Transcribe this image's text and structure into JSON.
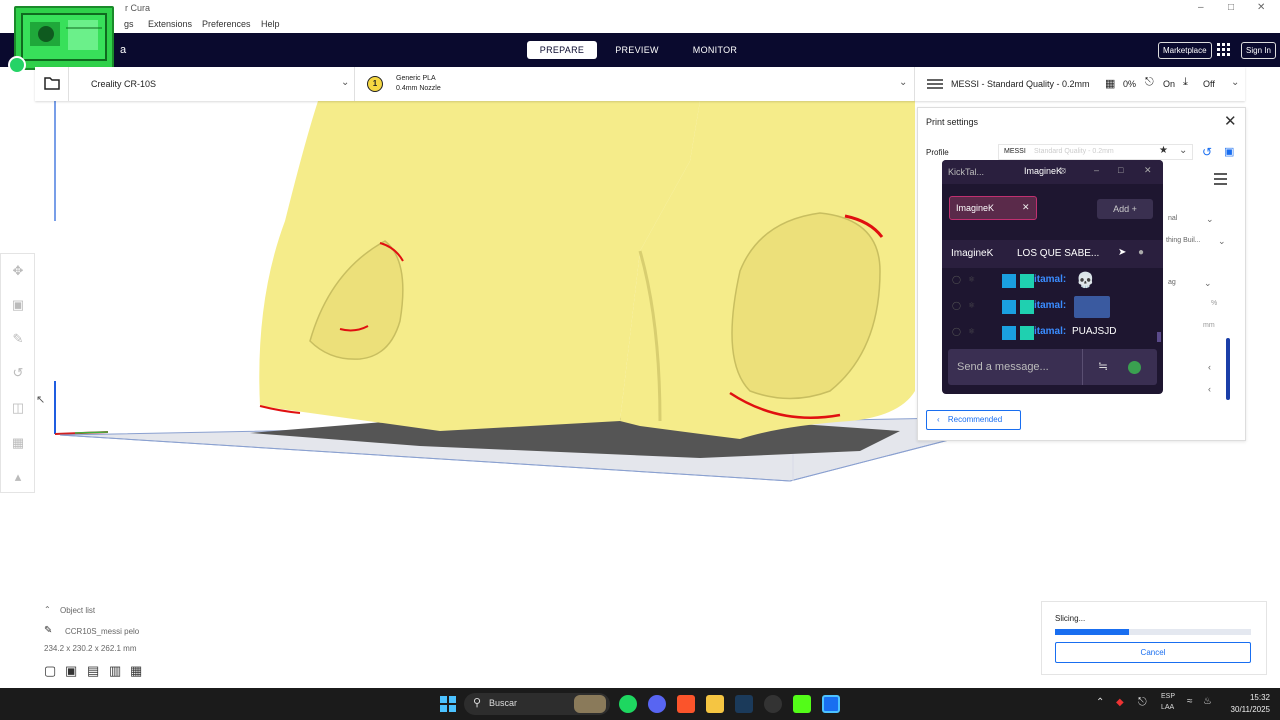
{
  "window": {
    "title": "r Cura"
  },
  "menu": {
    "items": [
      "gs",
      "Extensions",
      "Preferences",
      "Help"
    ]
  },
  "header": {
    "logo_suffix": "a",
    "tabs": [
      "PREPARE",
      "PREVIEW",
      "MONITOR"
    ],
    "active_tab": "PREPARE",
    "marketplace": "Marketplace",
    "signin": "Sign In"
  },
  "toolbar": {
    "printer": "Creality CR-10S",
    "extruder_number": "1",
    "material": "Generic PLA",
    "nozzle": "0.4mm Nozzle",
    "profile": "MESSI - Standard Quality - 0.2mm",
    "infill": "0%",
    "support": "On",
    "adhesion": "Off"
  },
  "print_settings": {
    "title": "Print settings",
    "profile_label": "Profile",
    "profile_value": "MESSI",
    "profile_hint": "Standard Quality - 0.2mm",
    "row_fragments": [
      "nal",
      "thing Buil...",
      "ag",
      "%",
      "mm"
    ],
    "recommended_label": "Recommended"
  },
  "chat": {
    "app_tab": "KickTal...",
    "channel_tab": "ImagineK",
    "channel_pill": "ImagineK",
    "add_label": "Add",
    "header_channel": "ImagineK",
    "header_title": "LOS QUE SABE...",
    "messages": [
      {
        "user": "itamal:",
        "text": "💀"
      },
      {
        "user": "itamal:",
        "text": ""
      },
      {
        "user": "itamal:",
        "text": "PUAJSJD"
      }
    ],
    "input_placeholder": "Send a message..."
  },
  "object_list": {
    "title": "Object list",
    "object_name": "CCR10S_messi pelo",
    "dimensions": "234.2 x 230.2 x 262.1 mm"
  },
  "slicing": {
    "label": "Slicing...",
    "progress": 0.38,
    "cancel": "Cancel"
  },
  "taskbar": {
    "search": "Buscar",
    "language": "ESP",
    "layout": "LAA",
    "time": "15:32",
    "date": "30/11/2025"
  },
  "colors": {
    "header_bg": "#0a0a2e",
    "accent": "#196ef0",
    "model": "#f5ec8a",
    "chat_bg": "#1e1630",
    "kick_green": "#53fc18"
  }
}
